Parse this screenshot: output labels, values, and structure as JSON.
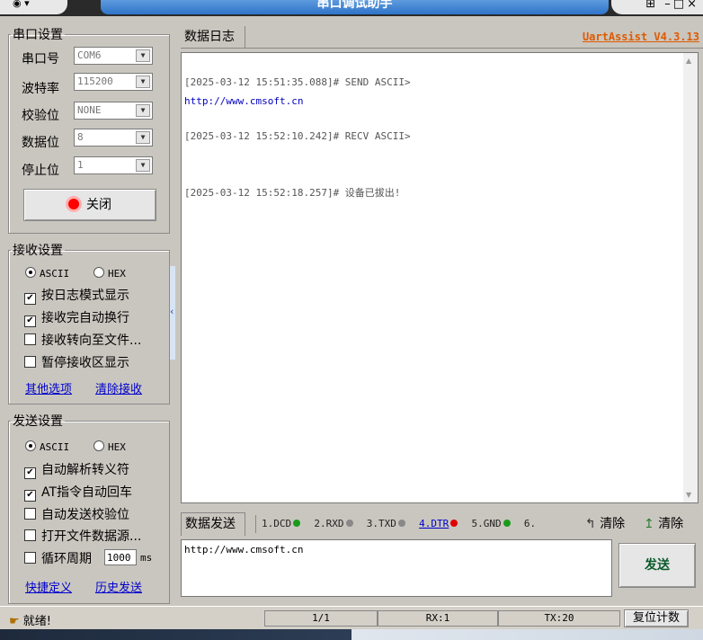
{
  "window": {
    "title": "串口调试助手"
  },
  "serial": {
    "legend": "串口设置",
    "port": {
      "label": "串口号",
      "value": "COM6"
    },
    "baud": {
      "label": "波特率",
      "value": "115200"
    },
    "parity": {
      "label": "校验位",
      "value": "NONE"
    },
    "databits": {
      "label": "数据位",
      "value": "8"
    },
    "stopbits": {
      "label": "停止位",
      "value": "1"
    },
    "close_label": "关闭"
  },
  "receive": {
    "legend": "接收设置",
    "ascii": "ASCII",
    "hex": "HEX",
    "options": [
      "按日志模式显示",
      "接收完自动换行",
      "接收转向至文件...",
      "暂停接收区显示"
    ],
    "more": "其他选项",
    "clear": "清除接收"
  },
  "send": {
    "legend": "发送设置",
    "ascii": "ASCII",
    "hex": "HEX",
    "options": [
      "自动解析转义符",
      "AT指令自动回车",
      "自动发送校验位",
      "打开文件数据源..."
    ],
    "cycle_label": "循环周期",
    "cycle_value": "1000",
    "cycle_unit": "ms",
    "shortcut": "快捷定义",
    "history": "历史发送"
  },
  "log": {
    "tab": "数据日志",
    "version": "UartAssist V4.3.13",
    "lines": [
      "[2025-03-12 15:51:35.088]# SEND ASCII>",
      "http://www.cmsoft.cn",
      "[2025-03-12 15:52:10.242]# RECV ASCII>",
      "[2025-03-12 15:52:18.257]# 设备已拔出!"
    ]
  },
  "sendbar": {
    "tab": "数据发送",
    "pins": [
      "1.DCD",
      "2.RXD",
      "3.TXD",
      "4.DTR",
      "5.GND",
      "6."
    ],
    "clear1": "清除",
    "clear2": "清除",
    "text": "http://www.cmsoft.cn",
    "send_label": "发送"
  },
  "status": {
    "ready": "就绪!",
    "page": "1/1",
    "rx": "RX:1",
    "tx": "TX:20",
    "reset": "复位计数"
  }
}
